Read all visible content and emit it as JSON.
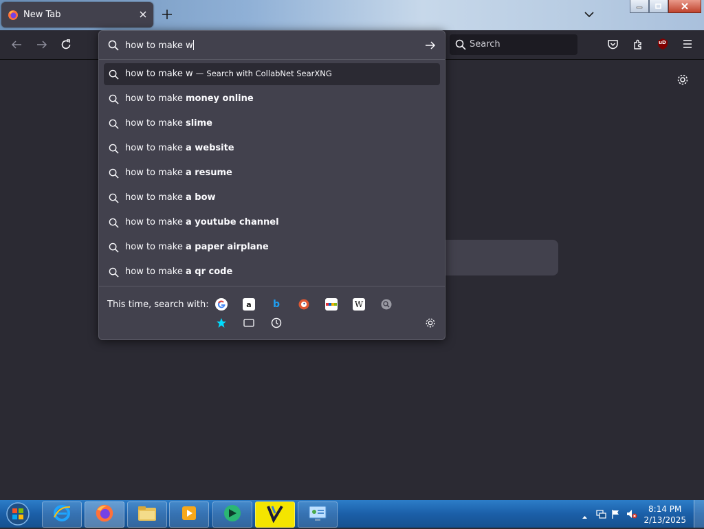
{
  "tab": {
    "title": "New Tab"
  },
  "url_bar": {
    "value": "how to make w"
  },
  "search_bar": {
    "placeholder": "Search"
  },
  "suggestions": [
    {
      "typed": "how to make w",
      "bold": "",
      "action_sep": "—",
      "action": "Search with CollabNet SearXNG",
      "selected": true
    },
    {
      "typed": "how to make ",
      "bold": "money online"
    },
    {
      "typed": "how to make ",
      "bold": "slime"
    },
    {
      "typed": "how to make ",
      "bold": "a website"
    },
    {
      "typed": "how to make ",
      "bold": "a resume"
    },
    {
      "typed": "how to make ",
      "bold": "a bow"
    },
    {
      "typed": "how to make ",
      "bold": "a youtube channel"
    },
    {
      "typed": "how to make ",
      "bold": "a paper airplane"
    },
    {
      "typed": "how to make ",
      "bold": "a qr code"
    }
  ],
  "one_offs": {
    "label": "This time, search with:",
    "engines": [
      "google",
      "amazon",
      "bing",
      "duckduckgo",
      "ebay",
      "wikipedia",
      "searxng"
    ],
    "modes": [
      "bookmarks",
      "tabs",
      "history"
    ]
  },
  "ublock_badge": "uD",
  "taskbar": {
    "apps": [
      "internet-explorer",
      "firefox",
      "file-explorer",
      "media-player",
      "app-green",
      "video-editor",
      "control-panel"
    ],
    "time": "8:14 PM",
    "date": "2/13/2025"
  }
}
